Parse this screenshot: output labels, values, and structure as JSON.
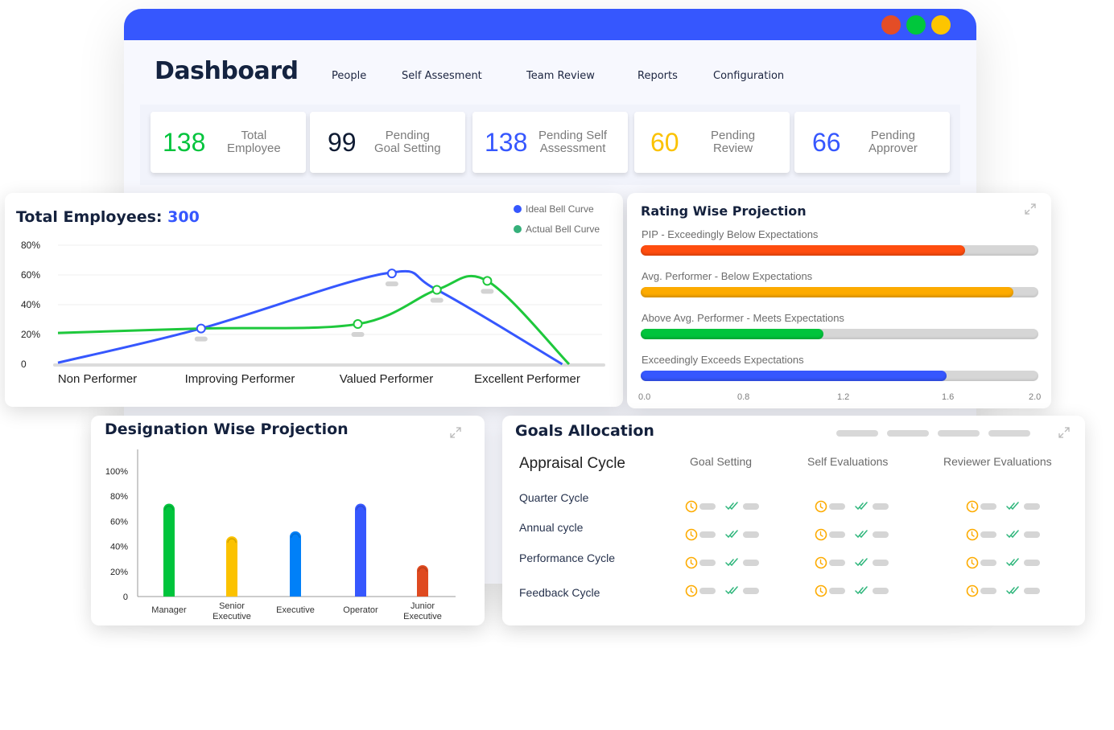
{
  "window": {
    "traffic_lights": [
      {
        "name": "close",
        "color": "#e44d26"
      },
      {
        "name": "minimize",
        "color": "#00c73c"
      },
      {
        "name": "maximize",
        "color": "#fdc500"
      }
    ],
    "accent_color": "#3657fe"
  },
  "nav": {
    "brand": "Dashboard",
    "items": [
      "People",
      "Self Assesment",
      "Team Review",
      "Reports",
      "Configuration"
    ]
  },
  "stats": [
    {
      "value": "138",
      "label_line1": "Total",
      "label_line2": "Employee",
      "color": "#00c43c"
    },
    {
      "value": "99",
      "label_line1": "Pending",
      "label_line2": "Goal Setting",
      "color": "#0f1b33"
    },
    {
      "value": "138",
      "label_line1": "Pending Self",
      "label_line2": "Assessment",
      "color": "#3657fe"
    },
    {
      "value": "60",
      "label_line1": "Pending",
      "label_line2": "Review",
      "color": "#fbc200"
    },
    {
      "value": "66",
      "label_line1": "Pending",
      "label_line2": "Approver",
      "color": "#3657fe"
    }
  ],
  "bell_curve": {
    "title_prefix": "Total Employees:",
    "title_value": "300",
    "chart_data": {
      "type": "line",
      "title": "Total Employees: 300",
      "categories": [
        "Non Performer",
        "Improving Performer",
        "Valued Performer",
        "Excellent Performer"
      ],
      "yticks": [
        "0",
        "20%",
        "40%",
        "60%",
        "80%"
      ],
      "ylim": [
        0,
        80
      ],
      "grid": true,
      "legend_position": "top-right",
      "series": [
        {
          "name": "Ideal Bell Curve",
          "color": "#3657fe",
          "points": [
            [
              0,
              1
            ],
            [
              1.05,
              24
            ],
            [
              2.4,
              61
            ],
            [
              2.78,
              50
            ],
            [
              3.7,
              0
            ]
          ]
        },
        {
          "name": "Actual Bell Curve",
          "color": "#1ec83c",
          "points": [
            [
              0,
              21
            ],
            [
              1.05,
              24
            ],
            [
              2.2,
              27
            ],
            [
              2.78,
              50
            ],
            [
              3.15,
              56
            ],
            [
              3.75,
              0
            ]
          ]
        }
      ],
      "markers": [
        {
          "series": "Ideal Bell Curve",
          "x": 1.05,
          "y": 24
        },
        {
          "series": "Ideal Bell Curve",
          "x": 2.45,
          "y": 61
        },
        {
          "series": "Actual Bell Curve",
          "x": 2.2,
          "y": 27
        },
        {
          "series": "Actual Bell Curve",
          "x": 2.78,
          "y": 50
        },
        {
          "series": "Actual Bell Curve",
          "x": 3.15,
          "y": 56
        }
      ]
    }
  },
  "rating": {
    "title": "Rating Wise Projection",
    "chart_data": {
      "type": "bar",
      "orientation": "horizontal",
      "title": "Rating Wise Projection",
      "xticks": [
        "0.0",
        "0.8",
        "1.2",
        "1.6",
        "2.0"
      ],
      "bars": [
        {
          "label": "PIP - Exceedingly Below Expectations",
          "fraction": 0.815,
          "color": "#ff4d0f"
        },
        {
          "label": "Avg. Performer - Below Expectations",
          "fraction": 0.938,
          "color": "#fdab00"
        },
        {
          "label": "Above Avg. Performer - Meets Expectations",
          "fraction": 0.46,
          "color": "#00c43c"
        },
        {
          "label": "Exceedingly Exceeds Expectations",
          "fraction": 0.77,
          "color": "#3657fe"
        }
      ]
    }
  },
  "designation": {
    "title": "Designation Wise Projection",
    "chart_data": {
      "type": "bar",
      "title": "Designation Wise Projection",
      "categories": [
        "Manager",
        "Senior Executive",
        "Executive",
        "Operator",
        "Junior Executive"
      ],
      "category_lines": [
        [
          "Manager"
        ],
        [
          "Senior",
          "Executive"
        ],
        [
          "Executive"
        ],
        [
          "Operator"
        ],
        [
          "Junior",
          "Executive"
        ]
      ],
      "values": [
        74,
        48,
        52,
        74,
        25
      ],
      "colors": [
        "#00c43c",
        "#fbc200",
        "#0080f8",
        "#3657fe",
        "#df4a20"
      ],
      "yticks": [
        "0",
        "20%",
        "40%",
        "60%",
        "80%",
        "100%"
      ],
      "ylim": [
        0,
        100
      ]
    }
  },
  "goals": {
    "title": "Goals Allocation",
    "header_label": "Appraisal Cycle",
    "columns": [
      "Goal Setting",
      "Self Evaluations",
      "Reviewer Evaluations"
    ],
    "rows": [
      "Quarter Cycle",
      "Annual cycle",
      "Performance Cycle",
      "Feedback Cycle"
    ],
    "pending_icon": "clock-icon",
    "done_icon": "double-check-icon",
    "pending_color": "#fdab00",
    "done_color": "#2fb67c"
  }
}
